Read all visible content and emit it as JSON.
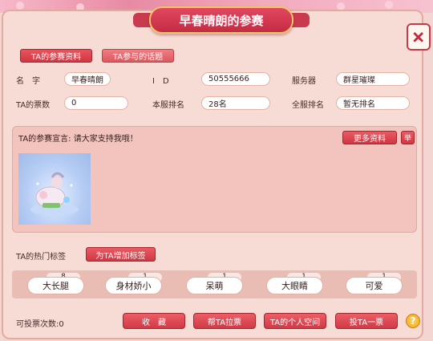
{
  "header": {
    "title": "早春晴朗的参赛"
  },
  "tabs": [
    {
      "label": "TA的参赛资料"
    },
    {
      "label": "TA参与的话题"
    }
  ],
  "profile": {
    "name_label": "名　字",
    "name_value": "早春晴朗",
    "id_label": "I　D",
    "id_value": "50555666",
    "server_label": "服务器",
    "server_value": "群星璀璨",
    "votes_label": "TA的票数",
    "votes_value": "0",
    "server_rank_label": "本服排名",
    "server_rank_value": "28名",
    "all_rank_label": "全服排名",
    "all_rank_value": "暂无排名"
  },
  "declaration": {
    "text": "TA的参赛宣言: 请大家支持我哦！",
    "more_label": "更多资料",
    "report_label": "举"
  },
  "tags": {
    "section_label": "TA的热门标签",
    "add_label": "为TA增加标签",
    "items": [
      {
        "label": "大长腿",
        "count": "8"
      },
      {
        "label": "身材娇小",
        "count": "1"
      },
      {
        "label": "呆萌",
        "count": "1"
      },
      {
        "label": "大眼睛",
        "count": "1"
      },
      {
        "label": "可爱",
        "count": "1"
      }
    ]
  },
  "footer": {
    "vote_count_text": "可投票次数:0",
    "buttons": {
      "favorite": "收　藏",
      "canvass": "帮TA拉票",
      "space": "TA的个人空间",
      "vote": "投TA一票"
    },
    "help_label": "?"
  },
  "colors": {
    "accent": "#d03a46",
    "panel": "#f6dcd5",
    "banner": "#c62b44"
  }
}
